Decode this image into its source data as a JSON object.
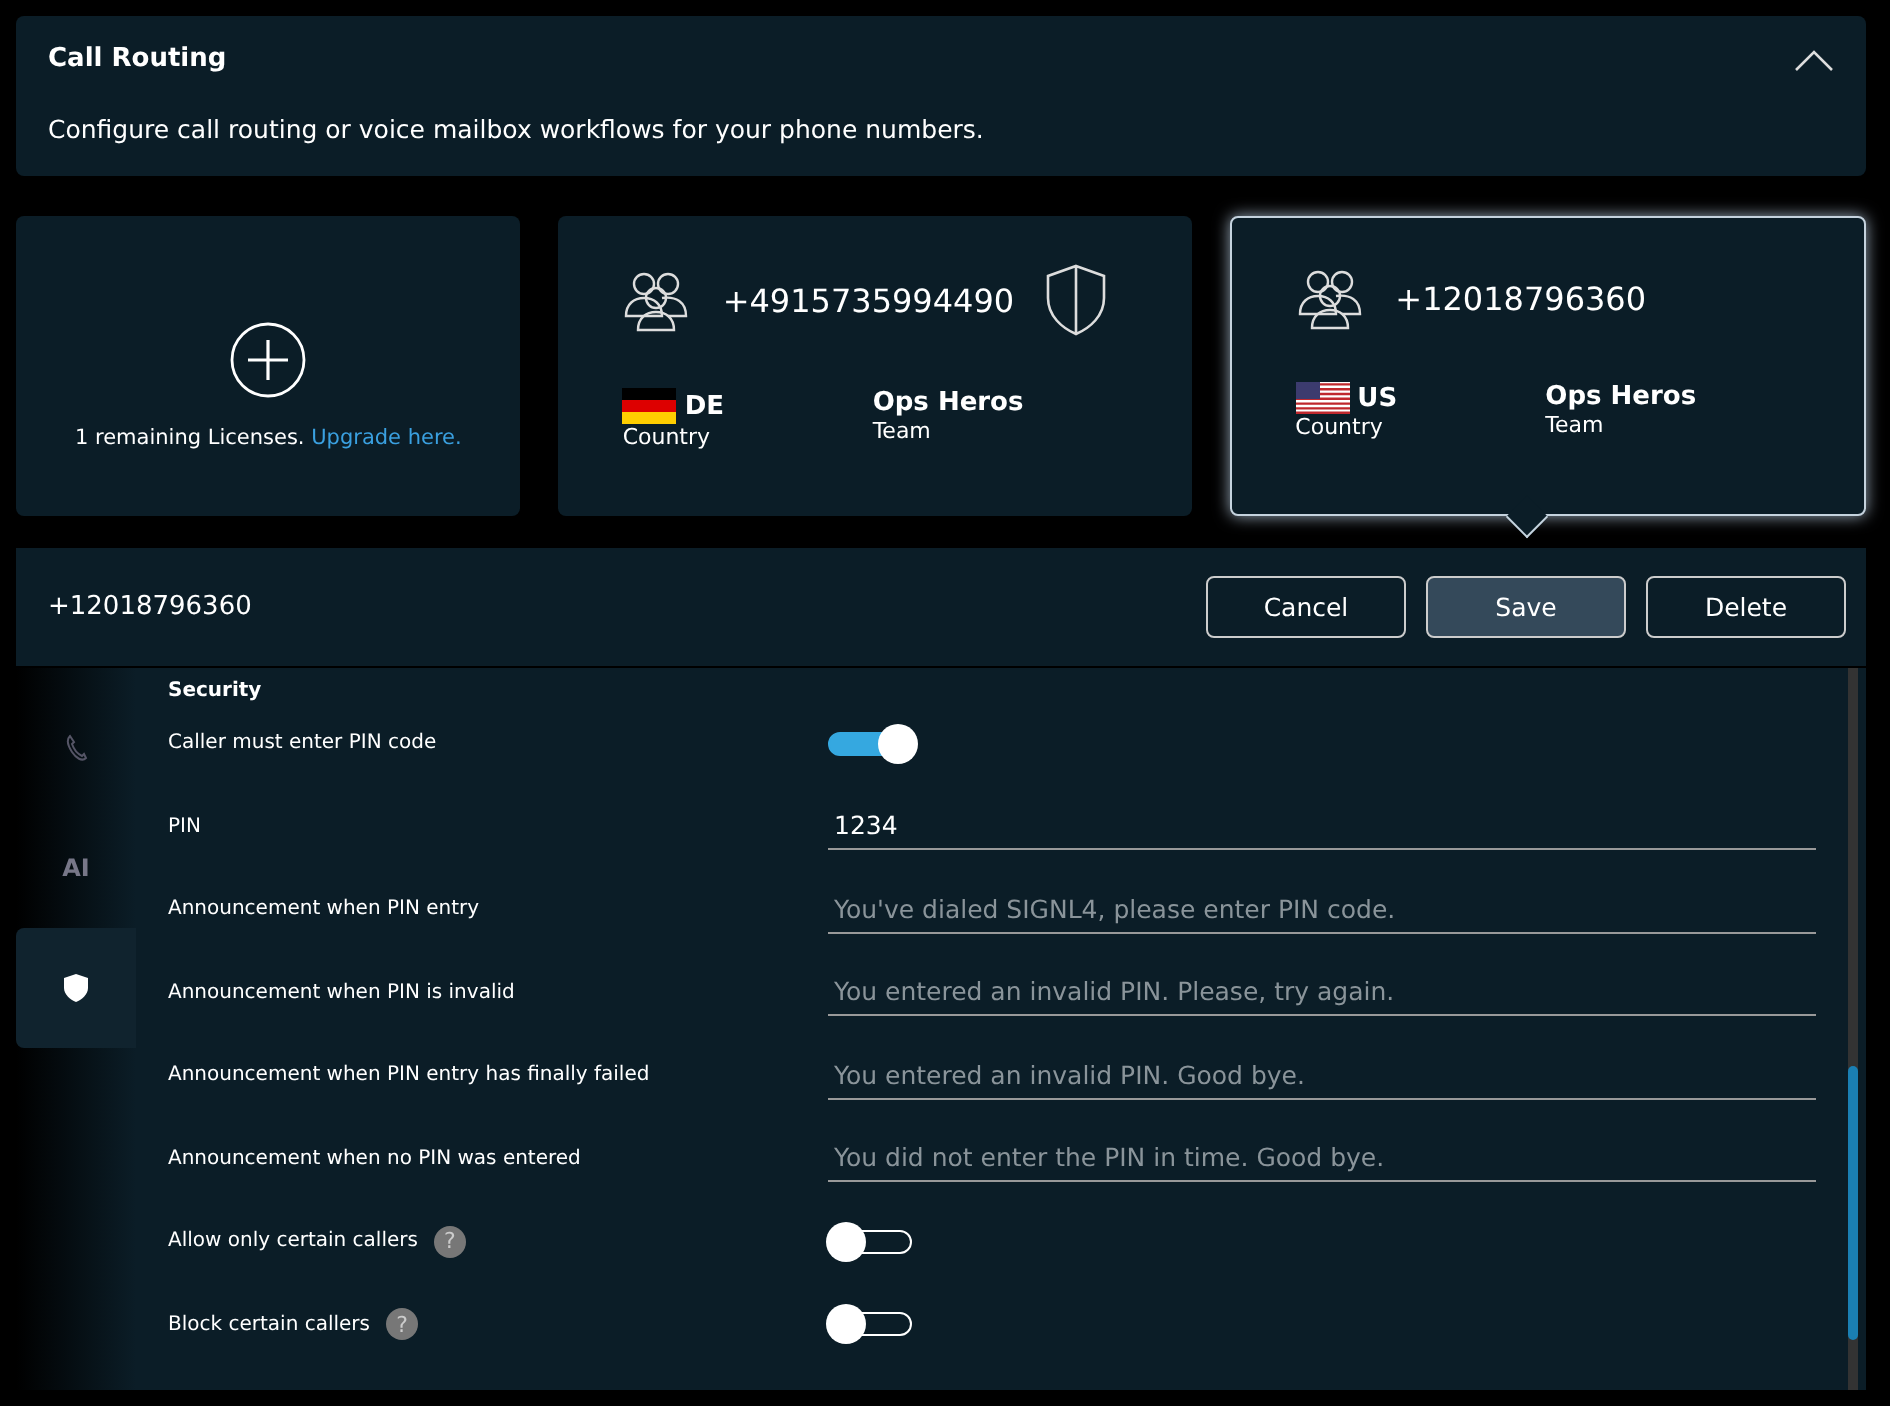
{
  "header": {
    "title": "Call Routing",
    "expanded": true,
    "description": "Configure call routing or voice mailbox workflows for your phone numbers."
  },
  "cards": [
    {
      "kind": "add",
      "text": "1 remaining Licenses.",
      "link": "Upgrade here.",
      "selected": false
    },
    {
      "kind": "number",
      "number": "+4915735994490",
      "protected": true,
      "flag": {
        "kind": "de"
      },
      "country": "DE",
      "country_label": "Country",
      "team": "Ops Heros",
      "team_label": "Team",
      "selected": false
    },
    {
      "kind": "number",
      "number": "+12018796360",
      "protected": false,
      "flag": {
        "kind": "us"
      },
      "country": "US",
      "country_label": "Country",
      "team": "Ops Heros",
      "team_label": "Team",
      "selected": true
    }
  ],
  "detail": {
    "number": "+12018796360",
    "buttons": [
      {
        "label": "Cancel",
        "primary": false
      },
      {
        "label": "Save",
        "primary": true
      },
      {
        "label": "Delete",
        "primary": false
      }
    ]
  },
  "side_tabs": [
    {
      "kind": "phone",
      "selected": false
    },
    {
      "kind": "ai",
      "label": "AI",
      "selected": false
    },
    {
      "kind": "shield",
      "selected": true
    }
  ],
  "section": "Security",
  "rows": [
    {
      "kind": "toggle",
      "label": "Caller must enter PIN code",
      "on": true
    },
    {
      "kind": "field",
      "label": "PIN",
      "value": "1234"
    },
    {
      "kind": "field",
      "label": "Announcement when PIN entry",
      "placeholder": "You've dialed SIGNL4, please enter PIN code."
    },
    {
      "kind": "field",
      "label": "Announcement when PIN is invalid",
      "placeholder": "You entered an invalid PIN. Please, try again."
    },
    {
      "kind": "field",
      "label": "Announcement when PIN entry has finally failed",
      "placeholder": "You entered an invalid PIN. Good bye."
    },
    {
      "kind": "field",
      "label": "Announcement when no PIN was entered",
      "placeholder": "You did not enter the PIN in time. Good bye."
    },
    {
      "kind": "toggle",
      "label": "Allow only certain callers",
      "on": false,
      "help": "?"
    },
    {
      "kind": "toggle",
      "label": "Block certain callers",
      "on": false,
      "help": "?"
    }
  ]
}
